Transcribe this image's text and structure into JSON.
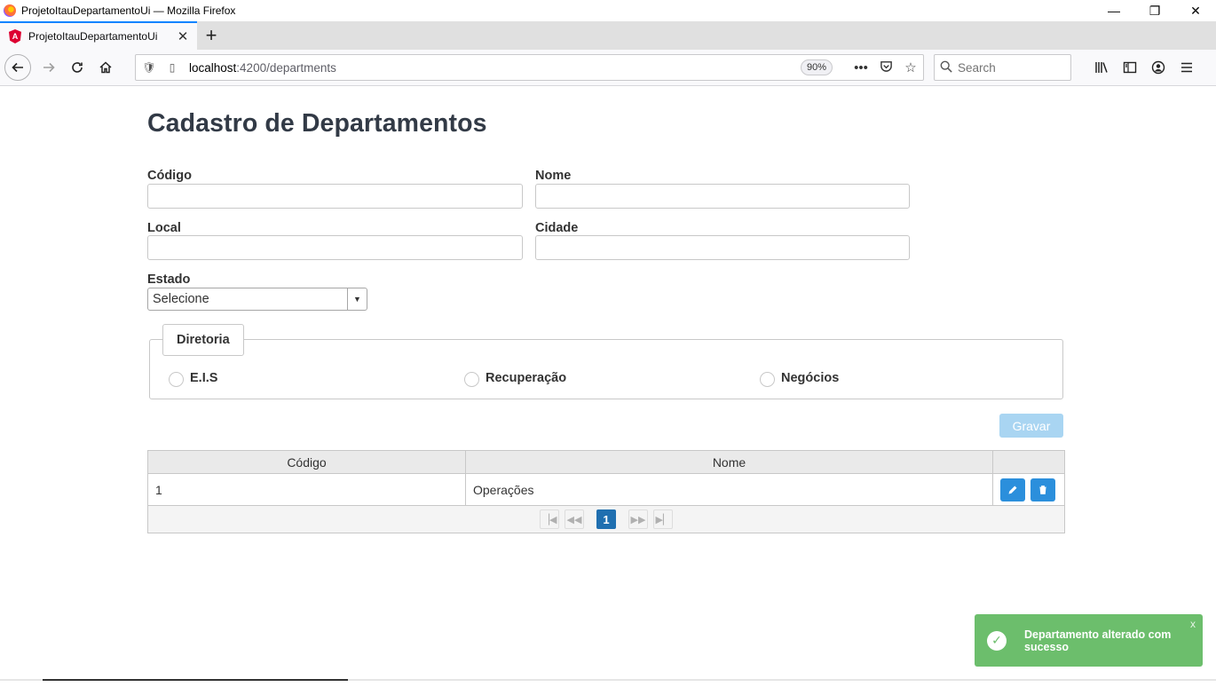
{
  "window": {
    "title": "ProjetoItauDepartamentoUi — Mozilla Firefox",
    "minimize": "—",
    "restore": "❐",
    "close": "✕"
  },
  "tab": {
    "label": "ProjetoItauDepartamentoUi",
    "close": "✕",
    "new_tab": "+"
  },
  "nav": {
    "url_host": "localhost",
    "url_path": ":4200/departments",
    "zoom": "90%",
    "search_placeholder": "Search"
  },
  "page": {
    "title": "Cadastro de Departamentos",
    "labels": {
      "codigo": "Código",
      "nome": "Nome",
      "local": "Local",
      "cidade": "Cidade",
      "estado": "Estado"
    },
    "estado_value": "Selecione",
    "diretoria": {
      "legend": "Diretoria",
      "options": [
        "E.I.S",
        "Recuperação",
        "Negócios"
      ]
    },
    "save_label": "Gravar",
    "table": {
      "headers": [
        "Código",
        "Nome",
        ""
      ],
      "rows": [
        {
          "codigo": "1",
          "nome": "Operações"
        }
      ],
      "current_page": "1"
    },
    "toast": {
      "message": "Departamento alterado com sucesso",
      "close": "x"
    }
  },
  "colors": {
    "save_button_disabled": "#a9d5f2",
    "row_action": "#2b8fdc",
    "toast_success": "#6cbe6c",
    "page_active": "#1f6fb0"
  }
}
